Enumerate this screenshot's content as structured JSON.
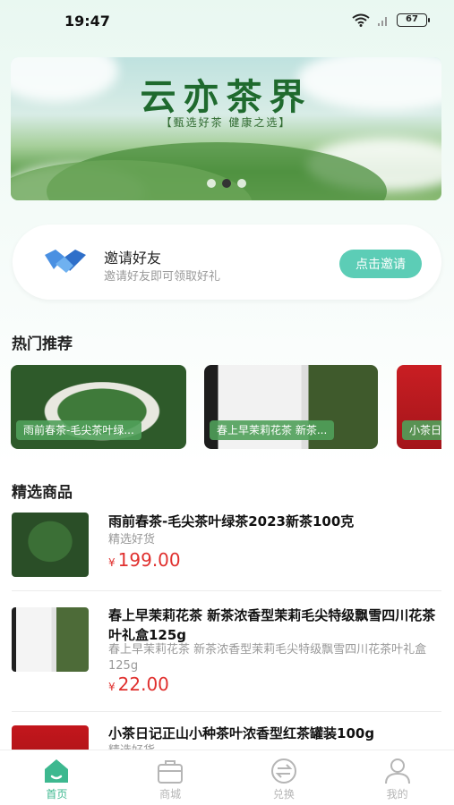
{
  "status_bar": {
    "time": "19:47",
    "battery": "67"
  },
  "banner": {
    "title": "云亦茶界",
    "subtitle": "【甄选好茶  健康之选】"
  },
  "invite": {
    "title": "邀请好友",
    "desc": "邀请好友即可领取好礼",
    "button": "点击邀请"
  },
  "sections": {
    "hot": "热门推荐",
    "featured": "精选商品"
  },
  "hot_items": [
    {
      "caption": "雨前春茶-毛尖茶叶绿..."
    },
    {
      "caption": "春上早茉莉花茶 新茶..."
    },
    {
      "caption": "小茶日"
    }
  ],
  "products": [
    {
      "name": "雨前春茶-毛尖茶叶绿茶2023新茶100克",
      "desc": "精选好货",
      "currency": "¥",
      "price": "199.00"
    },
    {
      "name": "春上早茉莉花茶 新茶浓香型茉莉毛尖特级飘雪四川花茶叶礼盒125g",
      "desc": "春上早茉莉花茶 新茶浓香型茉莉毛尖特级飘雪四川花茶叶礼盒125g",
      "currency": "¥",
      "price": "22.00"
    },
    {
      "name": "小茶日记正山小种茶叶浓香型红茶罐装100g",
      "desc": "精选好货"
    }
  ],
  "tabs": [
    {
      "label": "首页",
      "icon": "home-icon"
    },
    {
      "label": "商城",
      "icon": "bag-icon"
    },
    {
      "label": "兑换",
      "icon": "exchange-icon"
    },
    {
      "label": "我的",
      "icon": "user-icon"
    }
  ],
  "colors": {
    "accent": "#3db88f",
    "button": "#5ccdb6",
    "price": "#e0302e"
  }
}
